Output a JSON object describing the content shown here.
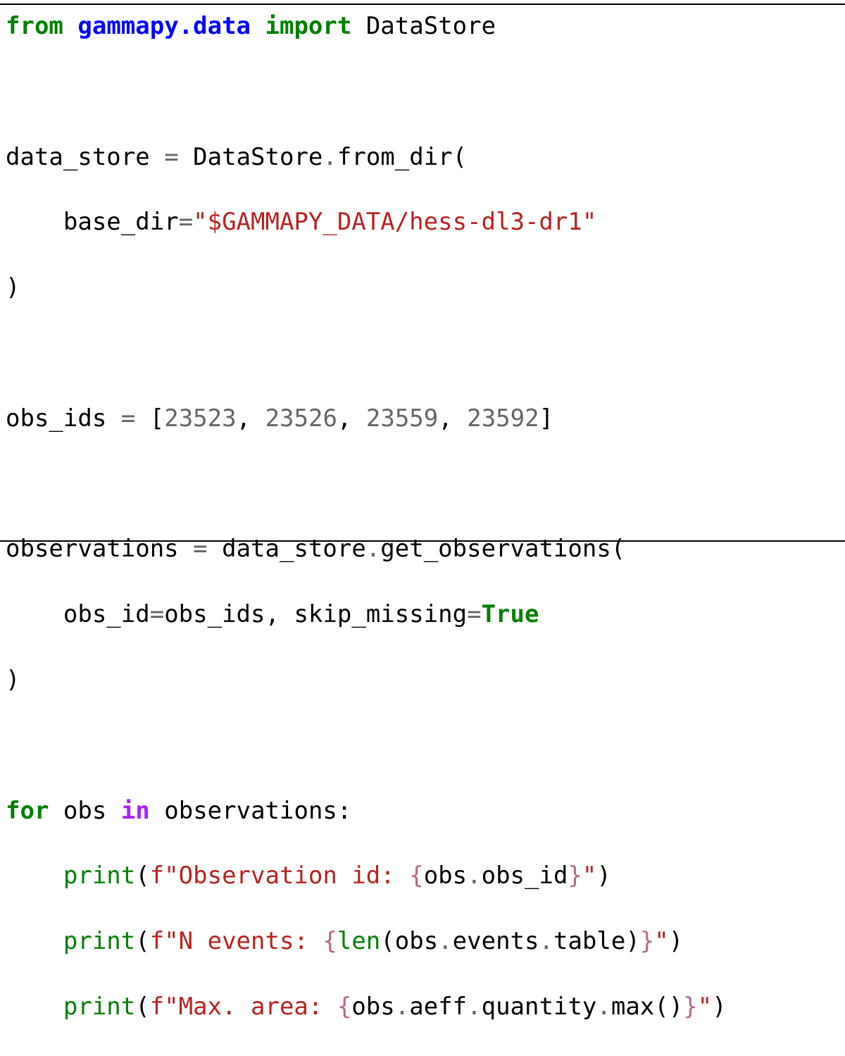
{
  "code": {
    "line1": {
      "kw_from": "from",
      "module": "gammapy.data",
      "kw_import": "import",
      "name": "DataStore"
    },
    "line3": {
      "var": "data_store",
      "eq": "=",
      "cls": "DataStore",
      "dot": ".",
      "method": "from_dir("
    },
    "line4": {
      "arg": "base_dir",
      "eq": "=",
      "str": "\"$GAMMAPY_DATA/hess-dl3-dr1\""
    },
    "line5": {
      "close": ")"
    },
    "line7": {
      "var": "obs_ids",
      "eq": "=",
      "open": "[",
      "n1": "23523",
      "n2": "23526",
      "n3": "23559",
      "n4": "23592",
      "close": "]",
      "sep": ","
    },
    "line9": {
      "var": "observations",
      "eq": "=",
      "obj": "data_store",
      "dot": ".",
      "method": "get_observations("
    },
    "line10": {
      "arg1": "obs_id",
      "eq": "=",
      "val1": "obs_ids,",
      "arg2": "skip_missing",
      "val2": "True"
    },
    "line11": {
      "close": ")"
    },
    "line13": {
      "kw_for": "for",
      "var": "obs",
      "kw_in": "in",
      "iter": "observations:"
    },
    "line14": {
      "fn": "print",
      "open": "(",
      "str": "f\"Observation id: ",
      "lb": "{",
      "expr_a": "obs",
      "dot": ".",
      "expr_b": "obs_id",
      "rb": "}",
      "end_str": "\"",
      "close": ")"
    },
    "line15": {
      "fn": "print",
      "open": "(",
      "str": "f\"N events: ",
      "lb": "{",
      "len": "len",
      "expr_a": "(obs",
      "dot1": ".",
      "expr_b": "events",
      "dot2": ".",
      "expr_c": "table)",
      "rb": "}",
      "end_str": "\"",
      "close": ")"
    },
    "line16": {
      "fn": "print",
      "open": "(",
      "str": "f\"Max. area: ",
      "lb": "{",
      "expr_a": "obs",
      "dot1": ".",
      "expr_b": "aeff",
      "dot2": ".",
      "expr_c": "quantity",
      "dot3": ".",
      "expr_d": "max()",
      "rb": "}",
      "end_str": "\"",
      "close": ")"
    }
  },
  "colors": {
    "keyword": "#008000",
    "module": "#0000ff",
    "string": "#ba2121",
    "number": "#666666",
    "operator_word": "#aa22ff",
    "interpolation": "#bb6688"
  }
}
